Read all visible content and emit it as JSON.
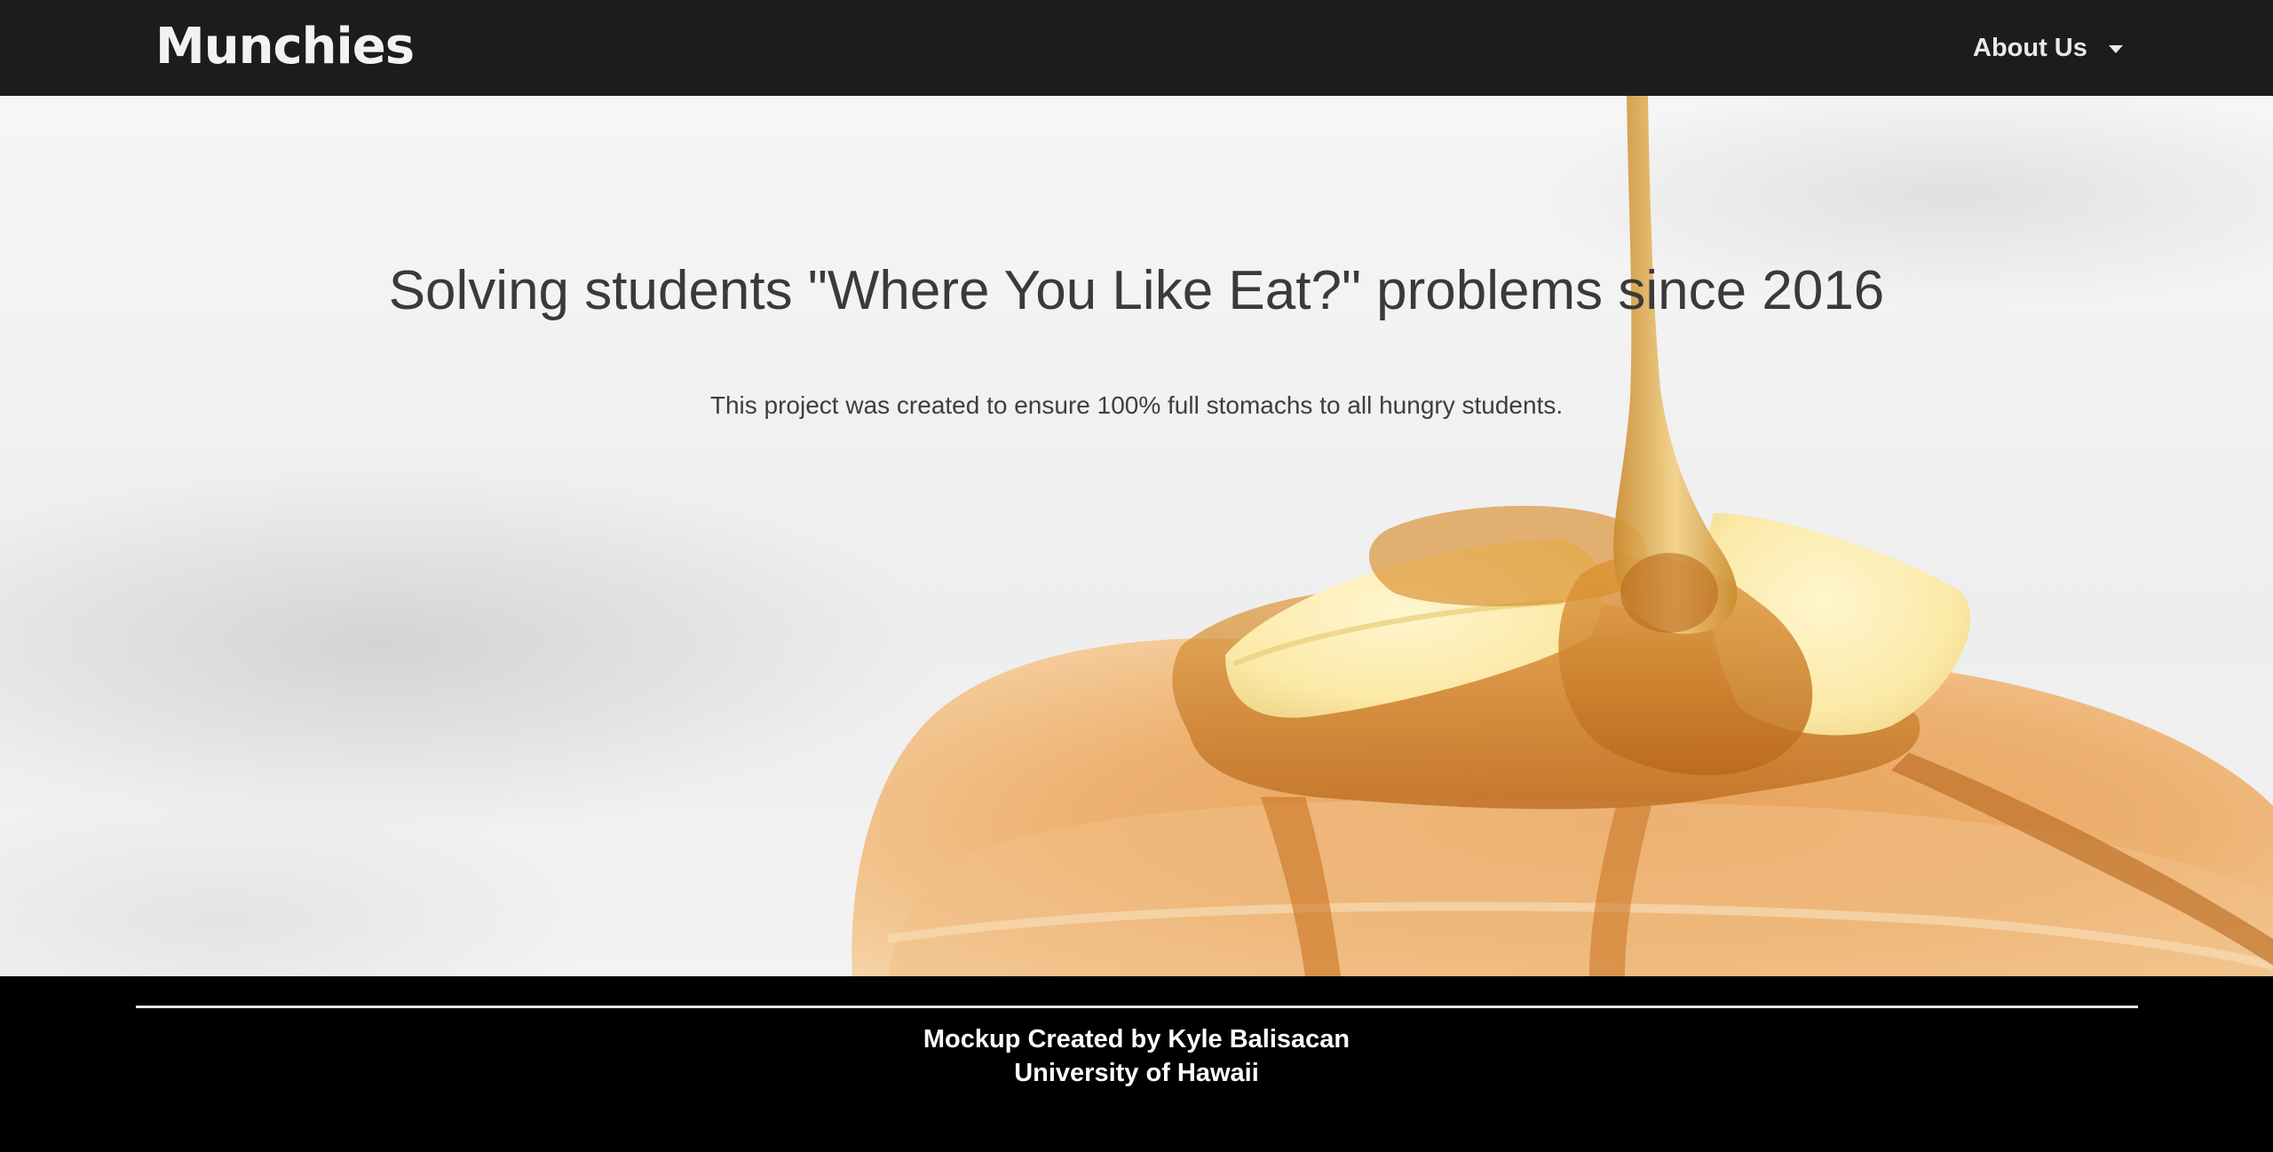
{
  "navbar": {
    "brand": "Munchies",
    "menu_label": "About Us",
    "menu_icon": "caret-down-icon"
  },
  "hero": {
    "headline": "Solving students \"Where You Like Eat?\" problems since 2016",
    "subtext": "This project was created to ensure 100% full stomachs to all hungry students.",
    "background_image": "pancakes-with-butter-and-syrup"
  },
  "footer": {
    "line1": "Mockup Created by Kyle Balisacan",
    "line2": "University of Hawaii"
  },
  "colors": {
    "navbar_bg": "#1b1c1d",
    "footer_bg": "#000000",
    "headline_text": "#3a3a3a",
    "syrup": "#c77a1c",
    "pancake": "#e9a35a"
  }
}
